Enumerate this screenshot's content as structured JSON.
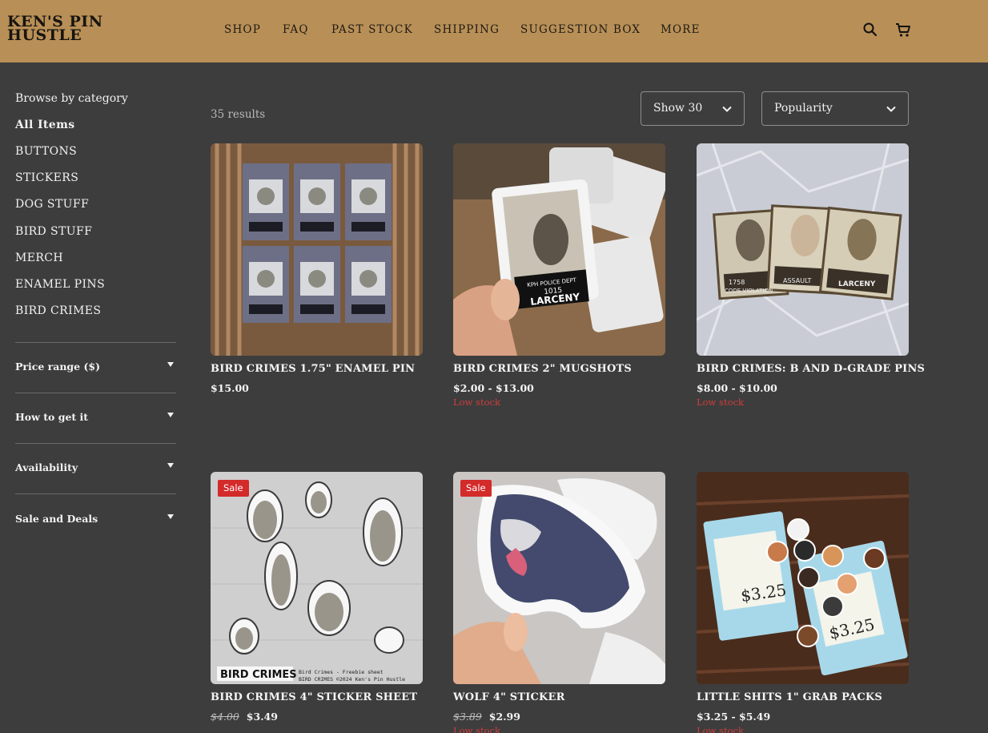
{
  "brand": {
    "line1": "KEN'S PIN",
    "line2": "HUSTLE"
  },
  "nav": [
    "SHOP",
    "FAQ",
    "PAST STOCK",
    "SHIPPING",
    "SUGGESTION BOX",
    "MORE"
  ],
  "icons": {
    "search": "search-icon",
    "cart": "cart-icon"
  },
  "sidebar": {
    "title": "Browse by category",
    "categories": [
      "All Items",
      "BUTTONS",
      "STICKERS",
      "DOG STUFF",
      "BIRD STUFF",
      "MERCH",
      "ENAMEL PINS",
      "BIRD CRIMES"
    ],
    "filters": [
      "Price range ($)",
      "How to get it",
      "Availability",
      "Sale and Deals"
    ]
  },
  "toolbar": {
    "results": "35 results",
    "show": "Show 30",
    "sort": "Popularity"
  },
  "colors": {
    "header": "#b88f56",
    "background": "#3d3d3d",
    "sale": "#d32a2a",
    "low_stock": "#d23c3c"
  },
  "products": [
    {
      "title": "BIRD CRIMES 1.75\" ENAMEL PIN",
      "price": "$15.00",
      "stock": ""
    },
    {
      "title": "BIRD CRIMES 2\" MUGSHOTS",
      "price": "$2.00 - $13.00",
      "stock": "Low stock"
    },
    {
      "title": "BIRD CRIMES: B AND D-GRADE PINS",
      "price": "$8.00 - $10.00",
      "stock": "Low stock"
    },
    {
      "title": "BIRD CRIMES 4\" STICKER SHEET",
      "old_price": "$4.00",
      "price": "$3.49",
      "badge": "Sale",
      "sheet_title": "BIRD CRIMES",
      "sheet_caption_1": "Bird Crimes - Freebie sheet",
      "sheet_caption_2": "BIRD CRIMES ©2024 Ken's Pin Hustle"
    },
    {
      "title": "WOLF 4\" STICKER",
      "old_price": "$3.89",
      "price": "$2.99",
      "badge": "Sale",
      "stock": "Low stock"
    },
    {
      "title": "LITTLE SHITS 1\" GRAB PACKS",
      "price": "$3.25 - $5.49",
      "stock": "Low stock"
    }
  ],
  "image_text": {
    "mugshot_dept": "KPH POLICE DEPT",
    "mugshot_number": "1015",
    "mugshot_charge": "LARCENY",
    "pin_number_left": "1758",
    "pin_charge_left": "CODE VIOLATION",
    "pin_charge_mid": "ASSAULT",
    "pack_price": "$3.25"
  }
}
